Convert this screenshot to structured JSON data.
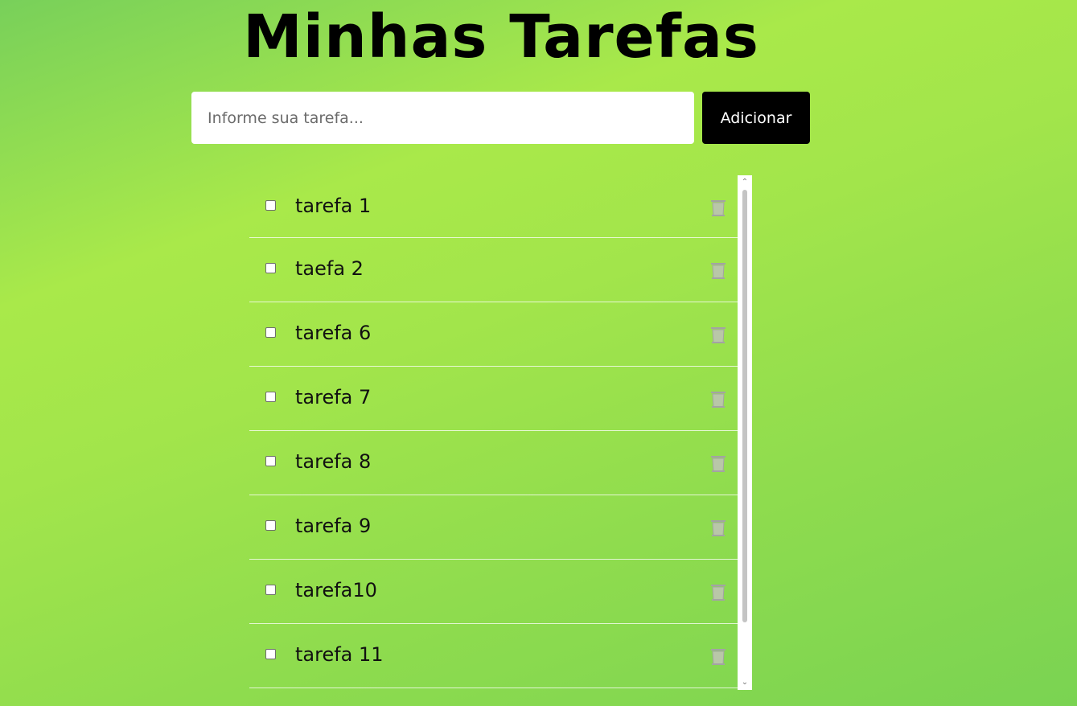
{
  "page": {
    "title": "Minhas Tarefas"
  },
  "form": {
    "placeholder": "Informe sua tarefa...",
    "value": "",
    "add_label": "Adicionar"
  },
  "tasks": [
    {
      "label": "tarefa 1",
      "checked": false
    },
    {
      "label": "taefa 2",
      "checked": false
    },
    {
      "label": "tarefa 6",
      "checked": false
    },
    {
      "label": "tarefa 7",
      "checked": false
    },
    {
      "label": "tarefa 8",
      "checked": false
    },
    {
      "label": "tarefa 9",
      "checked": false
    },
    {
      "label": "tarefa10",
      "checked": false
    },
    {
      "label": "tarefa 11",
      "checked": false
    }
  ],
  "icons": {
    "delete": "trash-icon",
    "scroll_up": "chevron-up-icon",
    "scroll_down": "chevron-down-icon"
  },
  "colors": {
    "background_gradient": [
      "#78d05a",
      "#a9e94a",
      "#7ad352"
    ],
    "button_bg": "#000000",
    "button_text": "#ffffff",
    "trash_icon": "#a3a3a3"
  }
}
